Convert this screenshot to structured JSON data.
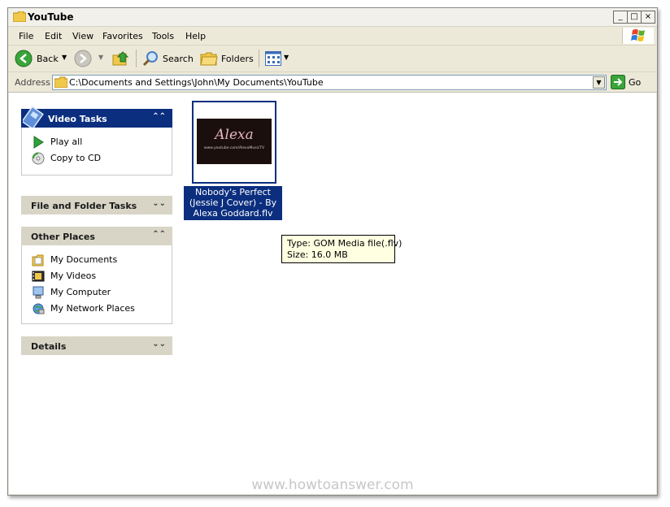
{
  "window": {
    "title": "YouTube",
    "buttons": {
      "minimize": "_",
      "maximize": "□",
      "close": "×"
    }
  },
  "menu": [
    "File",
    "Edit",
    "View",
    "Favorites",
    "Tools",
    "Help"
  ],
  "toolbar": {
    "back": "Back",
    "search": "Search",
    "folders": "Folders"
  },
  "address": {
    "label": "Address",
    "value": "C:\\Documents and Settings\\John\\My Documents\\YouTube",
    "go": "Go"
  },
  "panels": {
    "video_tasks": {
      "title": "Video Tasks",
      "items": [
        {
          "label": "Play all",
          "icon": "play-icon"
        },
        {
          "label": "Copy to CD",
          "icon": "cd-icon"
        }
      ]
    },
    "file_folder_tasks": {
      "title": "File and Folder Tasks"
    },
    "other_places": {
      "title": "Other Places",
      "items": [
        {
          "label": "My Documents",
          "icon": "my-documents-icon"
        },
        {
          "label": "My Videos",
          "icon": "my-videos-icon"
        },
        {
          "label": "My Computer",
          "icon": "my-computer-icon"
        },
        {
          "label": "My Network Places",
          "icon": "network-places-icon"
        }
      ]
    },
    "details": {
      "title": "Details"
    }
  },
  "file": {
    "name": "Nobody's Perfect (Jessie J Cover) - By Alexa Goddard.flv",
    "thumbnail_logo": "Alexa",
    "thumbnail_url": "www.youtube.com/AlexaMusicTV"
  },
  "tooltip": {
    "type": "Type: GOM Media file(.flv)",
    "size": "Size: 16.0 MB"
  },
  "watermark": "www.howtoanswer.com",
  "colors": {
    "selection": "#0b2e7f",
    "tooltip_bg": "#ffffe1",
    "panel_header": "#d8d5c6",
    "window_chrome": "#ece9d8"
  }
}
